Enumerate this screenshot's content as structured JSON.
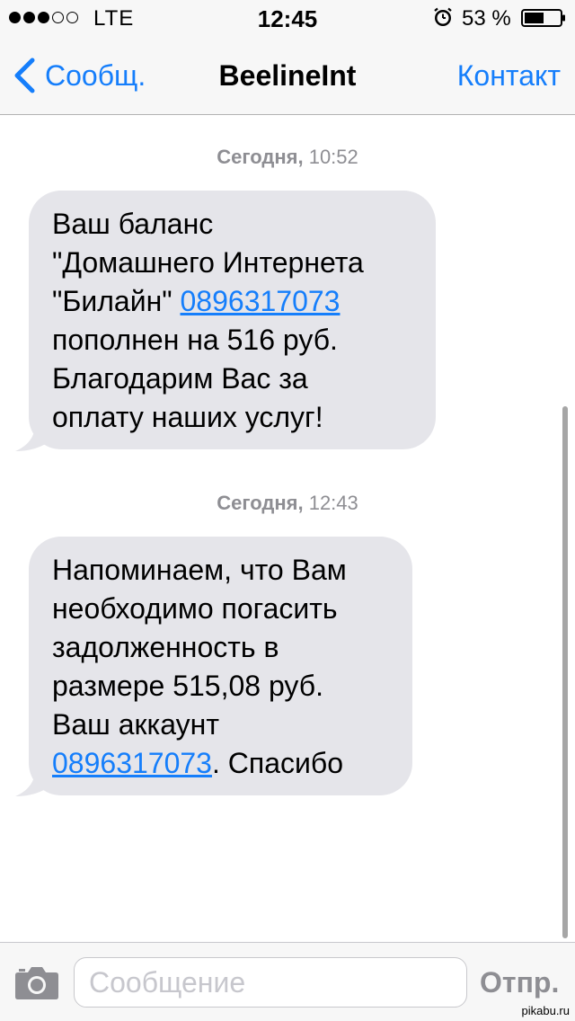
{
  "status_bar": {
    "carrier": "LTE",
    "time": "12:45",
    "battery_percent": "53 %",
    "signal_strength_filled": 3,
    "signal_strength_total": 5,
    "icons": [
      "signal-dots-icon",
      "alarm-clock-icon",
      "battery-icon"
    ]
  },
  "nav": {
    "back_label": "Сообщ.",
    "title": "BeelineInt",
    "contact_label": "Контакт",
    "icons": [
      "chevron-left-icon"
    ]
  },
  "messages": [
    {
      "day": "Сегодня,",
      "time": "10:52",
      "parts": {
        "before": "Ваш баланс\n\"Домашнего Интернета\n\"Билайн\" ",
        "link": "0896317073",
        "after": "\nпополнен на 516 руб.\nБлагодарим Вас за\nоплату наших услуг!"
      }
    },
    {
      "day": "Сегодня,",
      "time": "12:43",
      "parts": {
        "before": "Напоминаем, что Вам\nнеобходимо погасить\nзадолженность в\nразмере 515,08 руб.\nВаш аккаунт\n",
        "link": "0896317073",
        "after": ". Спасибо"
      }
    }
  ],
  "input_bar": {
    "placeholder": "Сообщение",
    "value": "",
    "send_label": "Отпр.",
    "icons": [
      "camera-icon"
    ]
  },
  "watermark": "pikabu.ru",
  "colors": {
    "accent": "#157efb",
    "bubble": "#e5e5ea",
    "bar_background": "#f7f7f7",
    "timestamp": "#8e8e93"
  }
}
